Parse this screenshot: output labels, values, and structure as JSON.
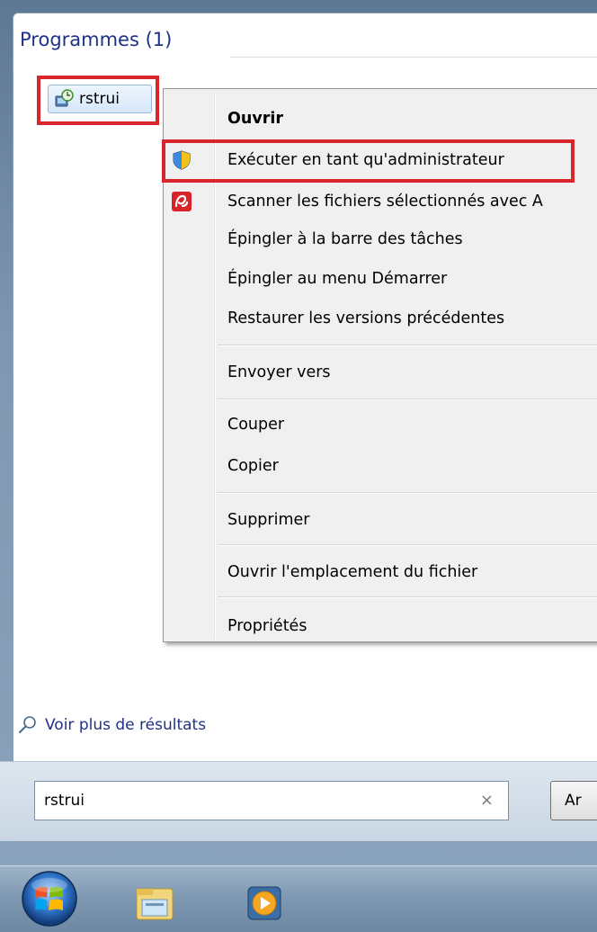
{
  "section": {
    "title": "Programmes (1)"
  },
  "result": {
    "label": "rstrui"
  },
  "context_menu": {
    "items": [
      {
        "label": "Ouvrir",
        "bold": true
      },
      {
        "label": "Exécuter en tant qu'administrateur",
        "icon": "uac-shield-icon"
      },
      {
        "label": "Scanner les fichiers sélectionnés avec A",
        "icon": "avira-icon"
      },
      {
        "label": "Épingler à la barre des tâches"
      },
      {
        "label": "Épingler au menu Démarrer"
      },
      {
        "label": "Restaurer les versions précédentes"
      },
      {
        "label": "Envoyer vers"
      },
      {
        "label": "Couper"
      },
      {
        "label": "Copier"
      },
      {
        "label": "Supprimer"
      },
      {
        "label": "Ouvrir l'emplacement du fichier"
      },
      {
        "label": "Propriétés"
      }
    ]
  },
  "more_results": {
    "label": "Voir plus de résultats"
  },
  "search": {
    "value": "rstrui",
    "clear_glyph": "×"
  },
  "shutdown_button": {
    "label": "Ar"
  },
  "taskbar": {
    "items": [
      "start-orb",
      "explorer-icon",
      "media-player-icon"
    ]
  },
  "colors": {
    "highlight_box": "#d9262c",
    "title_blue": "#1e3287"
  }
}
